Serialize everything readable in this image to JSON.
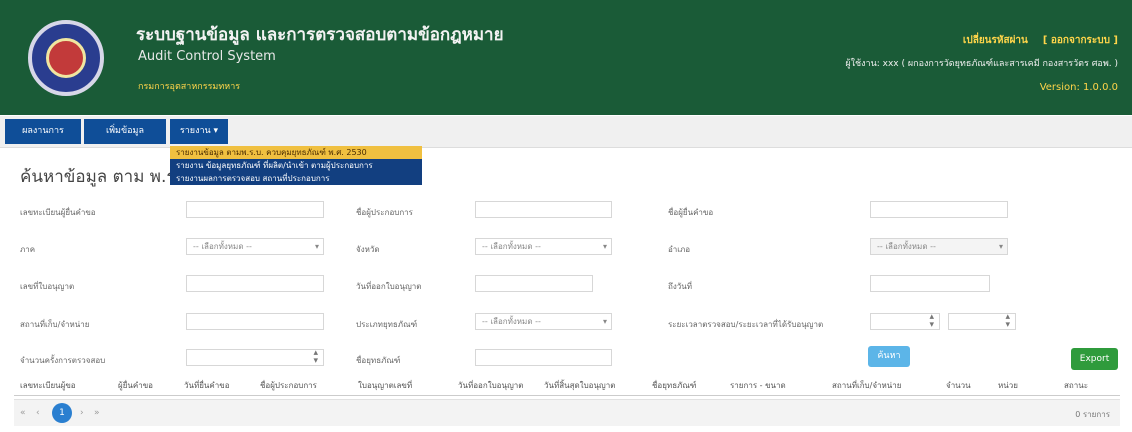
{
  "header": {
    "title_th": "ระบบฐานข้อมูล และการตรวจสอบตามข้อกฎหมาย",
    "title_en": "Audit Control System",
    "department": "กรมการอุตสาหกรรมทหาร",
    "change_password_link": "เปลี่ยนรหัสผ่าน",
    "logout_link": "[ ออกจากระบบ ]",
    "user_line": "ผู้ใช้งาน: xxx ( ผกองการวัดยุทธภัณฑ์และสารเคมี กองสารวัตร ศอพ. )",
    "version": "Version: 1.0.0.0"
  },
  "nav": {
    "items": [
      {
        "label": "ผลงานการ"
      },
      {
        "label": "เพิ่มข้อมูล"
      },
      {
        "label": "รายงาน"
      }
    ]
  },
  "dropdown": {
    "items": [
      {
        "label": "รายงานข้อมูล ตามพ.ร.บ. ควบคุมยุทธภัณฑ์ พ.ศ. 2530"
      },
      {
        "label": "รายงาน ข้อมูลยุทธภัณฑ์ ที่ผลิต/นำเข้า ตามผู้ประกอบการ"
      },
      {
        "label": "รายงานผลการตรวจสอบ สถานที่ประกอบการ"
      }
    ]
  },
  "page_title": "ค้นหาข้อมูล ตาม พ.ร.บ.",
  "filters": {
    "label_1": "เลขทะเบียนผู้ยื่นคำขอ",
    "label_2": "ชื่อผู้ประกอบการ",
    "label_3": "ชื่อผู้ยื่นคำขอ",
    "label_4": "ภาค",
    "select_4": "-- เลือกทั้งหมด --",
    "label_5": "จังหวัด",
    "select_5": "-- เลือกทั้งหมด --",
    "label_6": "อำเภอ",
    "select_6": "-- เลือกทั้งหมด --",
    "label_7": "เลขที่ใบอนุญาต",
    "label_8": "วันที่ออกใบอนุญาต",
    "label_9": "ถึงวันที่",
    "label_10": "สถานที่เก็บ/จำหน่าย",
    "label_11": "ประเภทยุทธภัณฑ์",
    "select_11": "-- เลือกทั้งหมด --",
    "label_12": "ระยะเวลาตรวจสอบ/ระยะเวลาที่ได้รับอนุญาต",
    "label_13": "จำนวนครั้งการตรวจสอบ",
    "label_14": "ชื่อยุทธภัณฑ์"
  },
  "buttons": {
    "search": "ค้นหา",
    "export": "Export"
  },
  "table": {
    "columns": [
      "เลขทะเบียนผู้ขอ",
      "ผู้ยื่นคำขอ",
      "วันที่ยื่นคำขอ",
      "ชื่อผู้ประกอบการ",
      "ใบอนุญาตเลขที่",
      "วันที่ออกใบอนุญาต",
      "วันที่สิ้นสุดใบอนุญาต",
      "ชื่อยุทธภัณฑ์",
      "รายการ - ขนาด",
      "สถานที่เก็บ/จำหน่าย",
      "จำนวน",
      "หน่วย",
      "สถานะ"
    ]
  },
  "pager": {
    "first": "«",
    "prev": "‹",
    "current": "1",
    "next": "›",
    "last": "»",
    "info": "0 รายการ"
  }
}
